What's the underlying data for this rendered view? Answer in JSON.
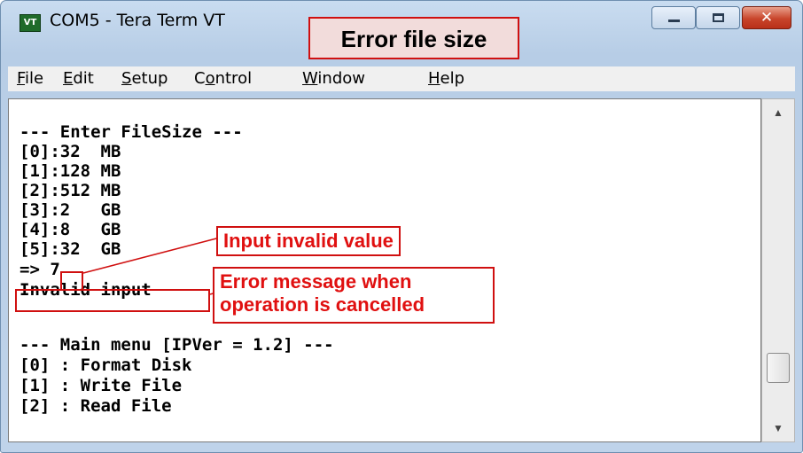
{
  "window": {
    "icon_label": "VT",
    "title": "COM5 - Tera Term VT",
    "controls": {
      "minimize": "minimize",
      "maximize": "maximize",
      "close": "✕"
    }
  },
  "callout_top": "Error file size",
  "menu": {
    "file": {
      "u": "F",
      "rest": "ile"
    },
    "edit": {
      "u": "E",
      "rest": "dit"
    },
    "setup": {
      "u": "S",
      "rest": "etup"
    },
    "control": {
      "pre": "C",
      "u": "o",
      "rest": "ntrol"
    },
    "window": {
      "u": "W",
      "rest": "indow"
    },
    "help": {
      "u": "H",
      "rest": "elp"
    }
  },
  "terminal": {
    "lines": [
      "--- Enter FileSize ---",
      "[0]:32  MB",
      "[1]:128 MB",
      "[2]:512 MB",
      "[3]:2   GB",
      "[4]:8   GB",
      "[5]:32  GB",
      "=> 7",
      "Invalid input",
      "",
      "--- Main menu [IPVer = 1.2] ---",
      "[0] : Format Disk",
      "[1] : Write File",
      "[2] : Read File"
    ]
  },
  "annotations": {
    "input_invalid": "Input invalid value",
    "error_message_line1": "Error message when",
    "error_message_line2": "operation is cancelled"
  },
  "scrollbar": {
    "up": "▲",
    "down": "▼"
  },
  "colors": {
    "callout_red": "#d01010",
    "callout_fill": "#f2dcdb",
    "title_bar": "#c9dcf0",
    "close_red": "#c8452b"
  }
}
